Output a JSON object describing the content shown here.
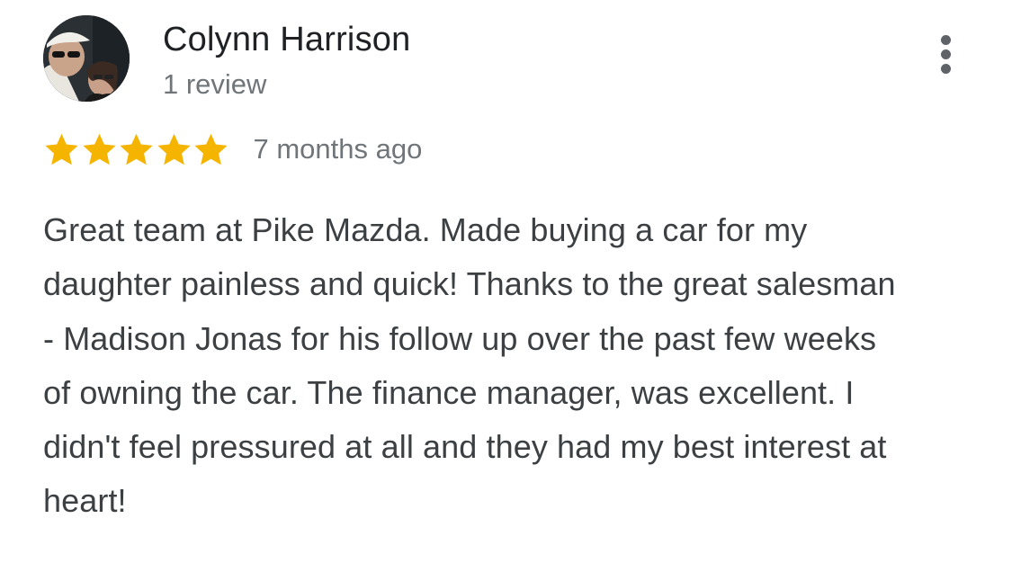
{
  "review": {
    "author": {
      "name": "Colynn Harrison",
      "review_count": "1 review",
      "avatar_icon": "profile-photo"
    },
    "rating": {
      "stars": 5,
      "max": 5,
      "star_color": "#f4b400",
      "star_icon": "star-icon"
    },
    "time_ago": "7 months ago",
    "text": "Great team at Pike Mazda. Made buying a car for my daughter painless and quick! Thanks to the great salesman - Madison Jonas for his follow up over the past few weeks of owning the car. The finance manager, was excellent. I didn't feel pressured at all and they had my best interest at heart!",
    "menu_icon": "more-vert-icon"
  },
  "colors": {
    "name": "#202124",
    "secondary": "#70757a",
    "body_text": "#3c4043",
    "menu_dots": "#5f6368"
  }
}
